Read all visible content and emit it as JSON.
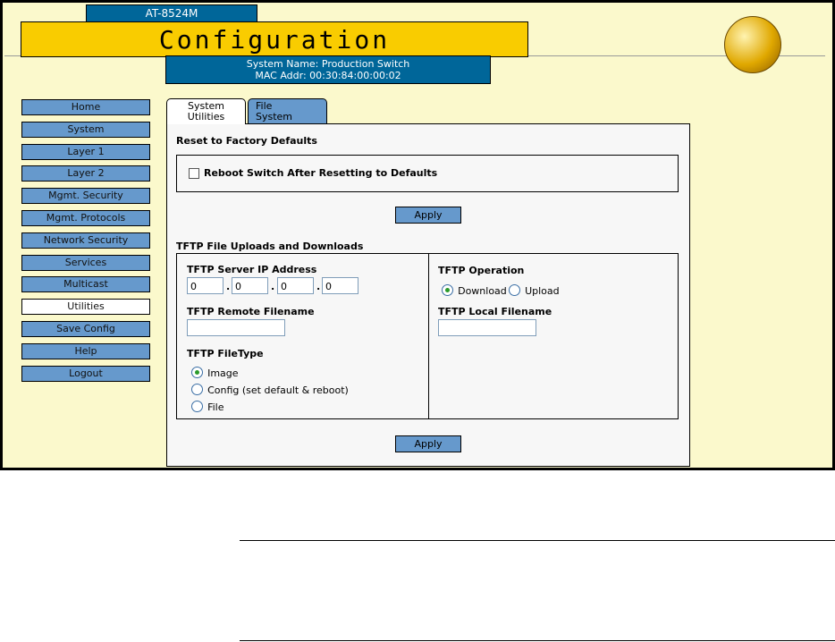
{
  "header": {
    "model": "AT-8524M",
    "title": "Configuration",
    "system_name": "System Name: Production Switch",
    "mac": "MAC Addr: 00:30:84:00:00:02"
  },
  "nav": [
    "Home",
    "System",
    "Layer 1",
    "Layer 2",
    "Mgmt. Security",
    "Mgmt. Protocols",
    "Network Security",
    "Services",
    "Multicast",
    "Utilities",
    "Save Config",
    "Help",
    "Logout"
  ],
  "tabs": {
    "t1a": "System",
    "t1b": "Utilities",
    "t2a": "File",
    "t2b": "System"
  },
  "reset": {
    "title": "Reset to Factory Defaults",
    "checkbox": "Reboot Switch After Resetting to Defaults",
    "apply": "Apply"
  },
  "tftp": {
    "title": "TFTP File Uploads and Downloads",
    "ip_label": "TFTP Server IP Address",
    "ip": [
      "0",
      "0",
      "0",
      "0"
    ],
    "remote_label": "TFTP Remote Filename",
    "remote": "",
    "filetype_label": "TFTP FileType",
    "filetypes": [
      "Image",
      "Config (set default & reboot)",
      "File"
    ],
    "op_label": "TFTP Operation",
    "download": "Download",
    "upload": "Upload",
    "local_label": "TFTP Local Filename",
    "local": "",
    "apply": "Apply"
  }
}
